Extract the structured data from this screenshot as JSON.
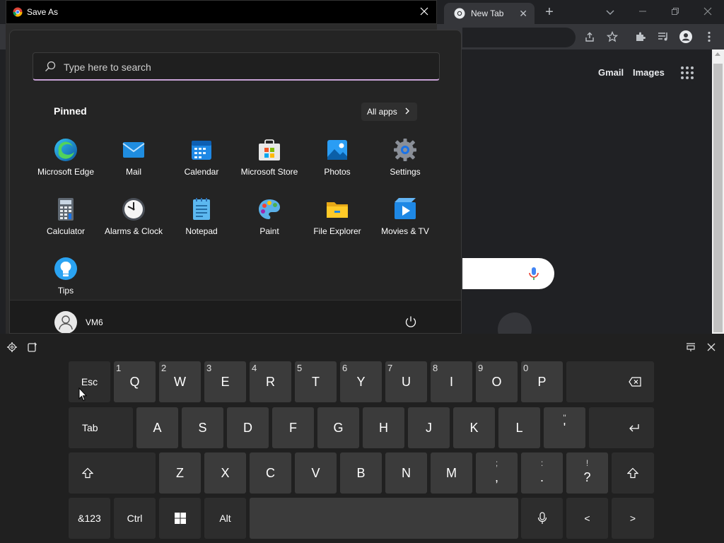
{
  "dialog": {
    "title": "Save As"
  },
  "browser": {
    "tab_title": "New Tab",
    "links": {
      "gmail": "Gmail",
      "images": "Images"
    }
  },
  "start_menu": {
    "search_placeholder": "Type here to search",
    "pinned_label": "Pinned",
    "all_apps_label": "All apps",
    "apps": [
      {
        "label": "Microsoft Edge",
        "icon": "edge-icon"
      },
      {
        "label": "Mail",
        "icon": "mail-icon"
      },
      {
        "label": "Calendar",
        "icon": "calendar-icon"
      },
      {
        "label": "Microsoft Store",
        "icon": "store-icon"
      },
      {
        "label": "Photos",
        "icon": "photos-icon"
      },
      {
        "label": "Settings",
        "icon": "settings-icon"
      },
      {
        "label": "Calculator",
        "icon": "calculator-icon"
      },
      {
        "label": "Alarms & Clock",
        "icon": "clock-icon"
      },
      {
        "label": "Notepad",
        "icon": "notepad-icon"
      },
      {
        "label": "Paint",
        "icon": "paint-icon"
      },
      {
        "label": "File Explorer",
        "icon": "folder-icon"
      },
      {
        "label": "Movies & TV",
        "icon": "movies-icon"
      },
      {
        "label": "Tips",
        "icon": "tips-icon"
      }
    ],
    "user_name": "VM6"
  },
  "keyboard": {
    "row1": [
      {
        "main": "Esc"
      },
      {
        "main": "Q",
        "num": "1"
      },
      {
        "main": "W",
        "num": "2"
      },
      {
        "main": "E",
        "num": "3"
      },
      {
        "main": "R",
        "num": "4"
      },
      {
        "main": "T",
        "num": "5"
      },
      {
        "main": "Y",
        "num": "6"
      },
      {
        "main": "U",
        "num": "7"
      },
      {
        "main": "I",
        "num": "8"
      },
      {
        "main": "O",
        "num": "9"
      },
      {
        "main": "P",
        "num": "0"
      }
    ],
    "row2": [
      {
        "main": "Tab"
      },
      {
        "main": "A"
      },
      {
        "main": "S"
      },
      {
        "main": "D"
      },
      {
        "main": "F"
      },
      {
        "main": "G"
      },
      {
        "main": "H"
      },
      {
        "main": "J"
      },
      {
        "main": "K"
      },
      {
        "main": "L"
      },
      {
        "main": "'",
        "sec": "\""
      }
    ],
    "row3": [
      {
        "main": "Z"
      },
      {
        "main": "X"
      },
      {
        "main": "C"
      },
      {
        "main": "V"
      },
      {
        "main": "B"
      },
      {
        "main": "N"
      },
      {
        "main": "M"
      },
      {
        "main": ",",
        "sec": ";"
      },
      {
        "main": ".",
        "sec": ":"
      },
      {
        "main": "?",
        "sec": "!"
      }
    ],
    "row4": {
      "symbols": "&123",
      "ctrl": "Ctrl",
      "alt": "Alt",
      "left": "<",
      "right": ">"
    }
  }
}
